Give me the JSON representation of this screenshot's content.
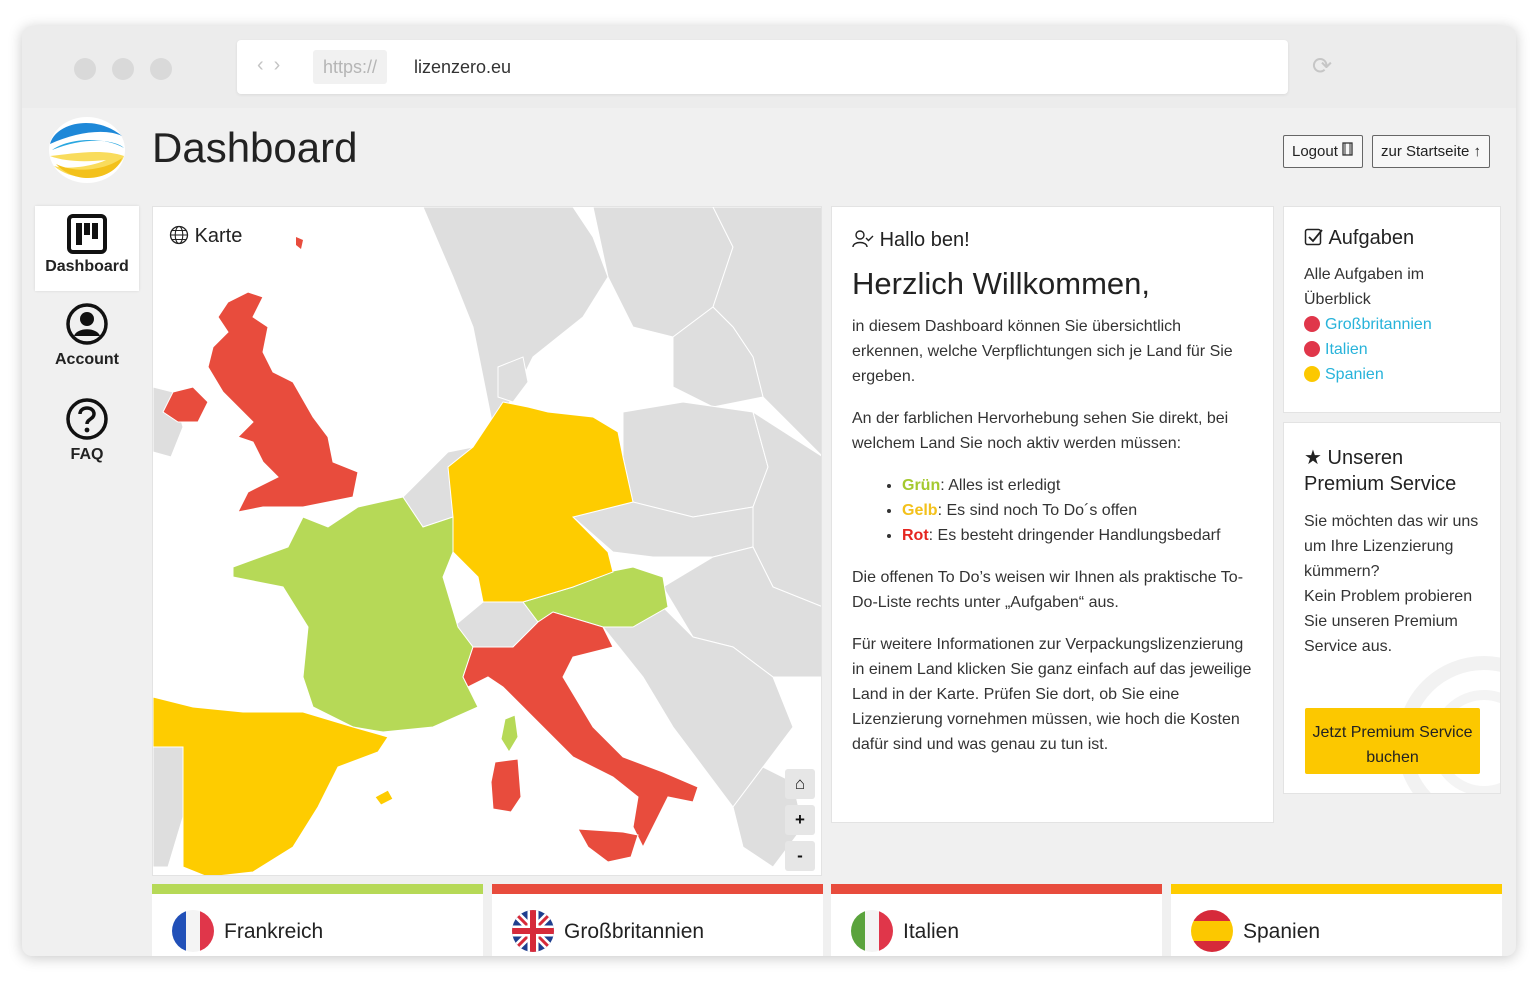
{
  "browser": {
    "protocol": "https://",
    "domain": "lizenzero.eu"
  },
  "header": {
    "title": "Dashboard",
    "logout_label": "Logout",
    "home_label": "zur Startseite"
  },
  "sidebar": {
    "items": [
      {
        "label": "Dashboard"
      },
      {
        "label": "Account"
      },
      {
        "label": "FAQ"
      }
    ]
  },
  "map": {
    "label": "Karte",
    "colors": {
      "green": "#b6d957",
      "yellow": "#fecc00",
      "red": "#e84c3d",
      "grey": "#dedede"
    }
  },
  "welcome": {
    "hello": "Hallo ben!",
    "title": "Herzlich Willkommen,",
    "p1": "in diesem Dashboard können Sie übersichtlich erkennen, welche Verpflichtungen sich je Land für Sie ergeben.",
    "p2": "An der farblichen Hervorhebung sehen Sie direkt, bei welchem Land Sie noch aktiv werden müssen:",
    "legend": [
      {
        "key": "Grün",
        "text": ": Alles ist erledigt"
      },
      {
        "key": "Gelb",
        "text": ": Es sind noch To Do´s offen"
      },
      {
        "key": "Rot",
        "text": ": Es besteht dringender Handlungsbedarf"
      }
    ],
    "p3": "Die offenen To Do’s weisen wir Ihnen als praktische To-Do-Liste rechts unter „Aufgaben“ aus.",
    "p4": "Für weitere Informationen zur Verpackungslizenzierung in einem Land klicken Sie ganz einfach auf das jeweilige Land in der Karte. Prüfen Sie dort, ob Sie eine Lizenzierung vornehmen müssen, wie hoch die Kosten dafür sind und was genau zu tun ist."
  },
  "tasks": {
    "title": "Aufgaben",
    "intro": "Alle Aufgaben im Überblick",
    "items": [
      {
        "label": "Großbritannien",
        "color": "#e0364a"
      },
      {
        "label": "Italien",
        "color": "#e0364a"
      },
      {
        "label": "Spanien",
        "color": "#fcc800"
      }
    ]
  },
  "premium": {
    "title": "Unseren Premium Service",
    "text1": "Sie möchten das wir uns um Ihre Lizenzierung kümmern?",
    "text2": "Kein Problem probieren Sie unseren Premium Service aus.",
    "button": "Jetzt Premium Service buchen"
  },
  "countries": [
    {
      "name": "Frankreich",
      "status_color": "#b6d957"
    },
    {
      "name": "Großbritannien",
      "status_color": "#e84c3d"
    },
    {
      "name": "Italien",
      "status_color": "#e84c3d"
    },
    {
      "name": "Spanien",
      "status_color": "#fecc00"
    }
  ]
}
